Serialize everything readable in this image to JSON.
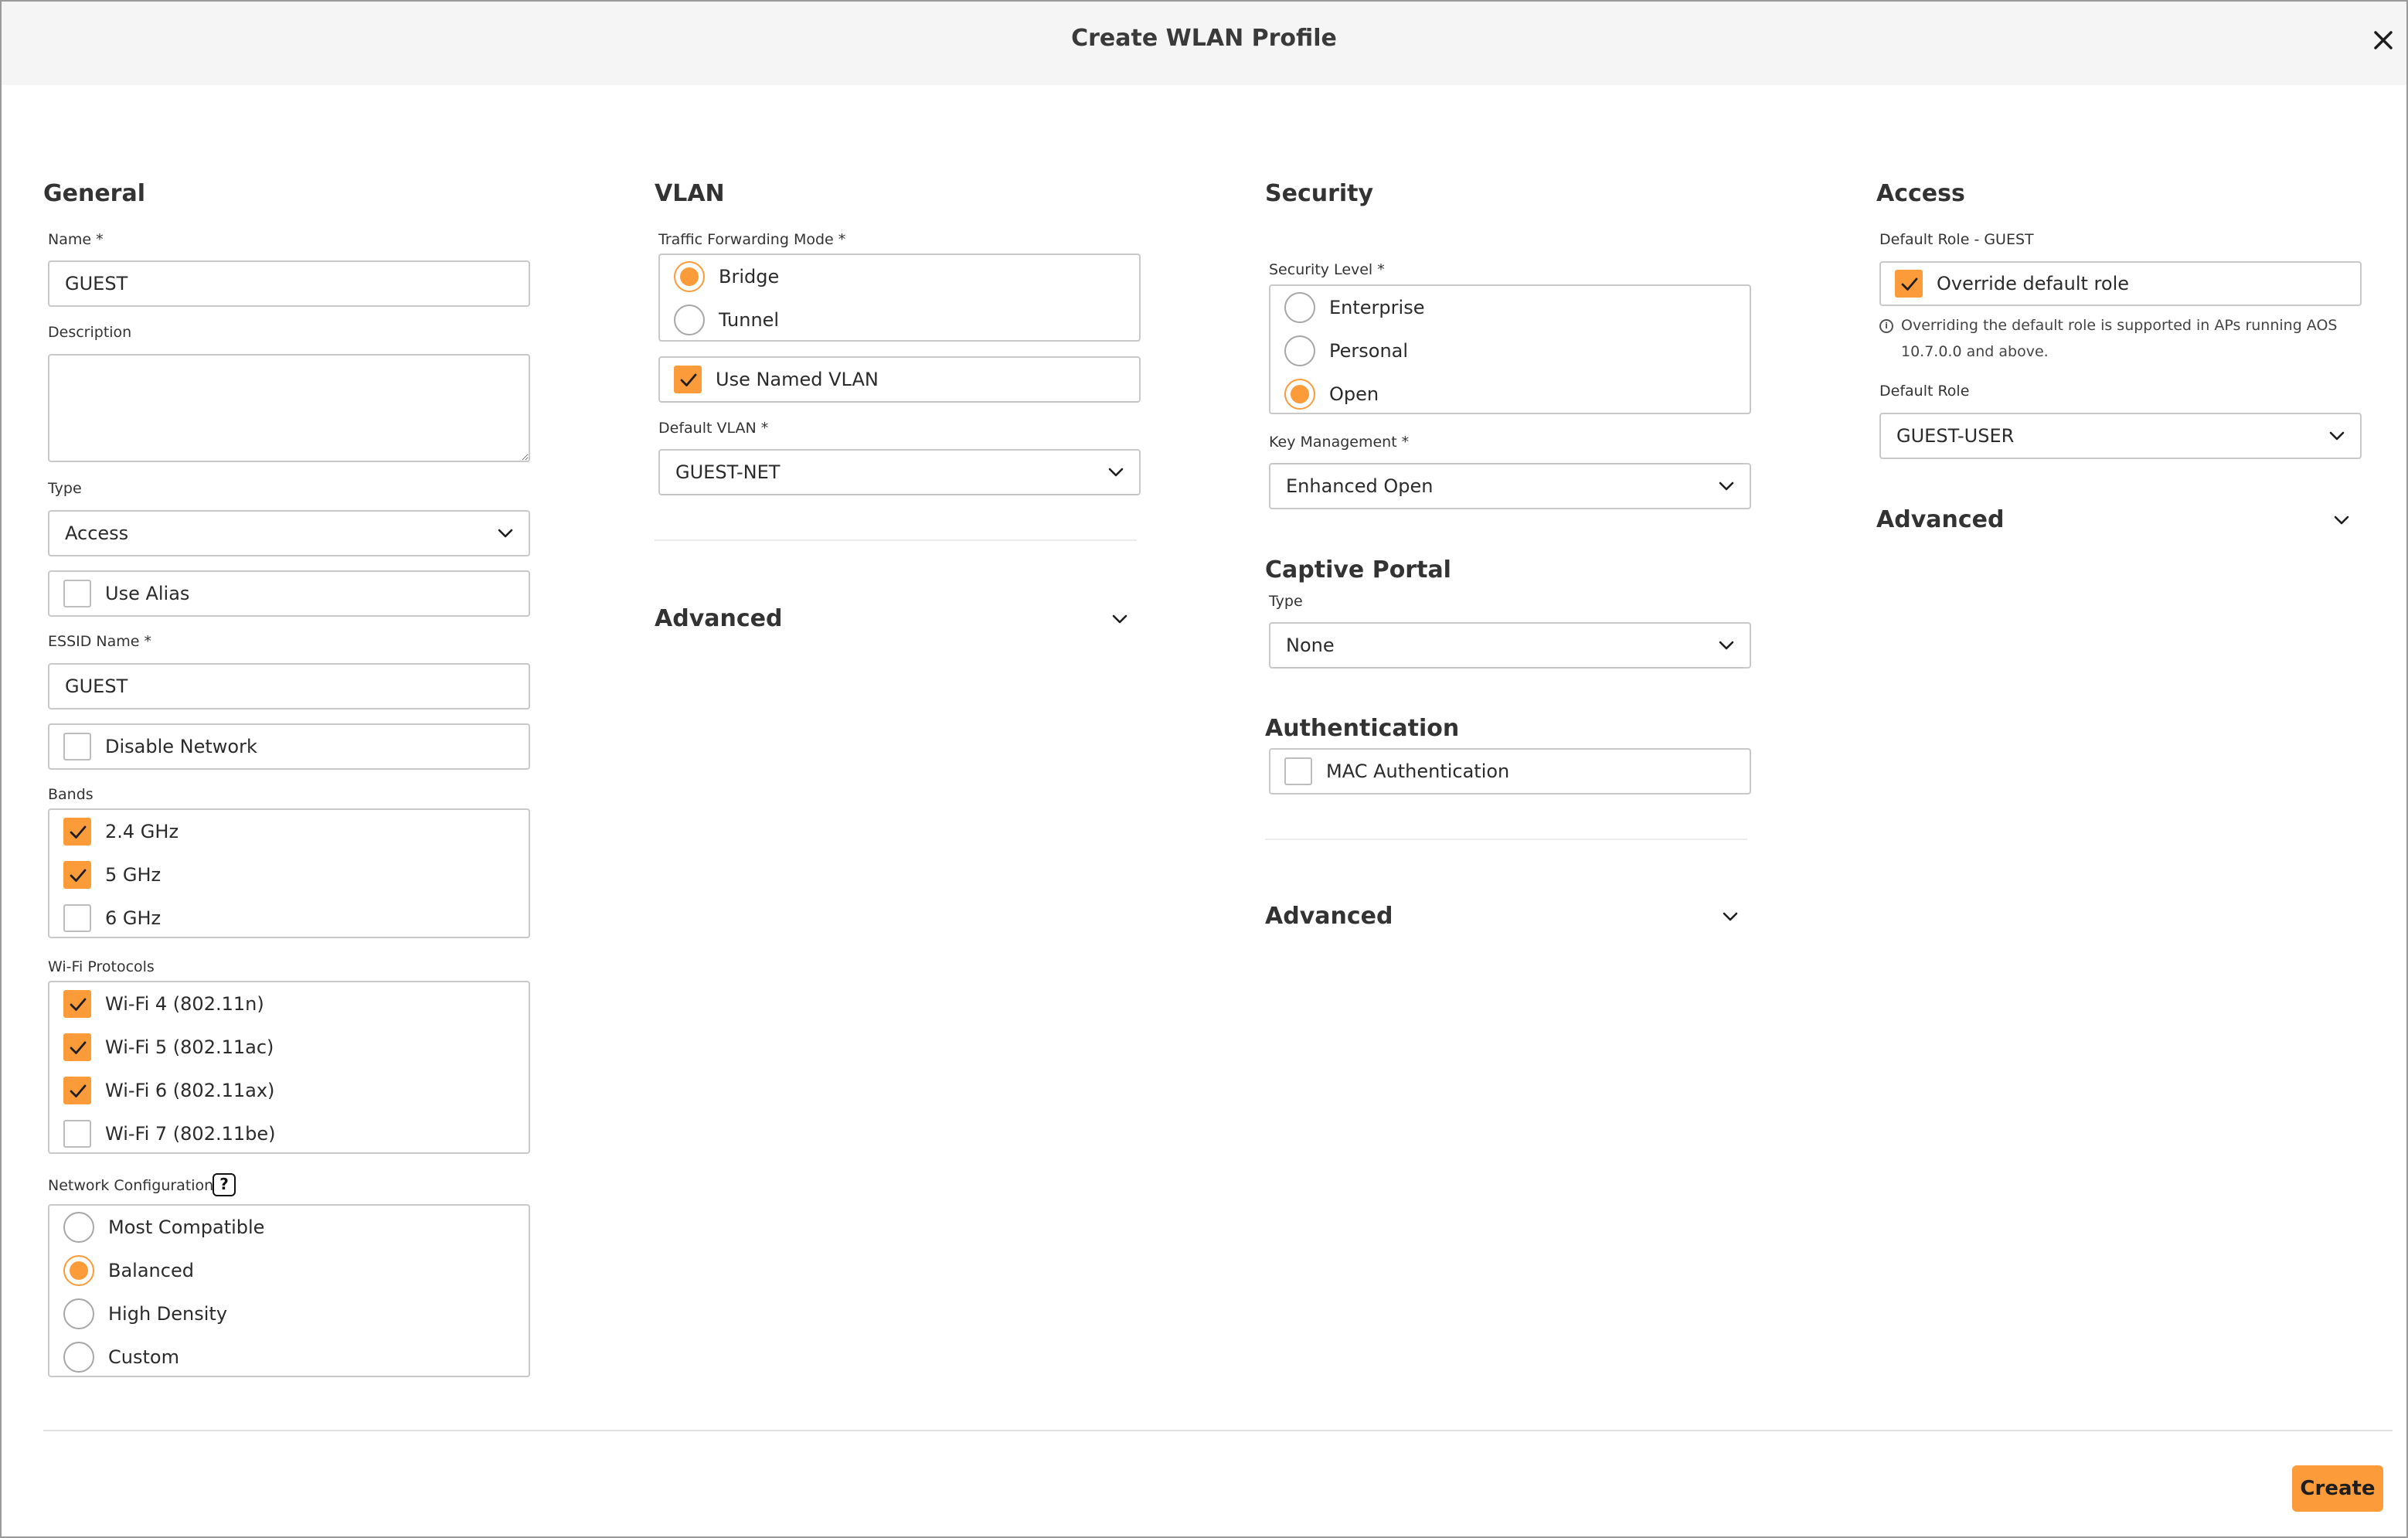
{
  "dialog": {
    "title": "Create WLAN Profile",
    "close_icon": "close-icon"
  },
  "general": {
    "heading": "General",
    "name_label": "Name *",
    "name_value": "GUEST",
    "description_label": "Description",
    "description_value": "",
    "type_label": "Type",
    "type_value": "Access",
    "use_alias_label": "Use Alias",
    "use_alias_checked": false,
    "essid_label": "ESSID Name *",
    "essid_value": "GUEST",
    "disable_network_label": "Disable Network",
    "disable_network_checked": false,
    "bands_label": "Bands",
    "bands": [
      {
        "label": "2.4 GHz",
        "checked": true
      },
      {
        "label": "5 GHz",
        "checked": true
      },
      {
        "label": "6 GHz",
        "checked": false
      }
    ],
    "protocols_label": "Wi-Fi Protocols",
    "protocols": [
      {
        "label": "Wi-Fi 4 (802.11n)",
        "checked": true
      },
      {
        "label": "Wi-Fi 5 (802.11ac)",
        "checked": true
      },
      {
        "label": "Wi-Fi 6 (802.11ax)",
        "checked": true
      },
      {
        "label": "Wi-Fi 7 (802.11be)",
        "checked": false
      }
    ],
    "network_config_label": "Network Configuration",
    "network_config_help": "?",
    "network_config_options": [
      {
        "label": "Most Compatible",
        "selected": false
      },
      {
        "label": "Balanced",
        "selected": true
      },
      {
        "label": "High Density",
        "selected": false
      },
      {
        "label": "Custom",
        "selected": false
      }
    ]
  },
  "vlan": {
    "heading": "VLAN",
    "forwarding_label": "Traffic Forwarding Mode *",
    "forwarding_options": [
      {
        "label": "Bridge",
        "selected": true
      },
      {
        "label": "Tunnel",
        "selected": false
      }
    ],
    "use_named_vlan_label": "Use Named VLAN",
    "use_named_vlan_checked": true,
    "default_vlan_label": "Default VLAN *",
    "default_vlan_value": "GUEST-NET",
    "advanced_label": "Advanced"
  },
  "security": {
    "heading": "Security",
    "level_label": "Security Level *",
    "level_options": [
      {
        "label": "Enterprise",
        "selected": false
      },
      {
        "label": "Personal",
        "selected": false
      },
      {
        "label": "Open",
        "selected": true
      }
    ],
    "key_mgmt_label": "Key Management *",
    "key_mgmt_value": "Enhanced Open",
    "captive_portal_heading": "Captive Portal",
    "captive_type_label": "Type",
    "captive_type_value": "None",
    "authentication_heading": "Authentication",
    "mac_auth_label": "MAC Authentication",
    "mac_auth_checked": false,
    "advanced_label": "Advanced"
  },
  "access": {
    "heading": "Access",
    "default_role_group_label": "Default Role - GUEST",
    "override_label": "Override default role",
    "override_checked": true,
    "info_icon": "info-icon",
    "info_text": "Overriding the default role is supported in APs running AOS 10.7.0.0 and above.",
    "default_role_label": "Default Role",
    "default_role_value": "GUEST-USER",
    "advanced_label": "Advanced"
  },
  "footer": {
    "create_label": "Create"
  },
  "colors": {
    "accent": "#fb9b3a",
    "border": "#c9c9c9",
    "header_bg": "#f5f5f5"
  }
}
